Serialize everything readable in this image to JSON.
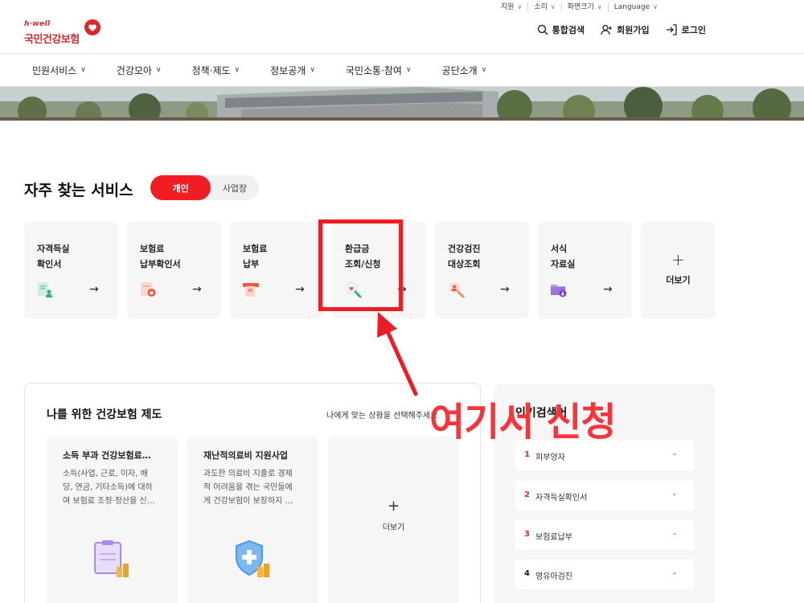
{
  "utility": {
    "items": [
      {
        "label": "지원"
      },
      {
        "label": "소리"
      },
      {
        "label": "화면크기"
      },
      {
        "label": "Language"
      }
    ]
  },
  "logo": {
    "small": "h·well",
    "main": "국민건강보험"
  },
  "header": {
    "search_label": "통합검색",
    "signup_label": "회원가입",
    "login_label": "로그인"
  },
  "gnb": {
    "items": [
      {
        "label": "민원서비스"
      },
      {
        "label": "건강모아"
      },
      {
        "label": "정책·제도"
      },
      {
        "label": "정보공개"
      },
      {
        "label": "국민소통·참여"
      },
      {
        "label": "공단소개"
      }
    ]
  },
  "services": {
    "title": "자주 찾는 서비스",
    "tabs": [
      {
        "label": "개인",
        "active": true
      },
      {
        "label": "사업장",
        "active": false
      }
    ],
    "cards": [
      {
        "line1": "자격득실",
        "line2": "확인서",
        "icon": "document-person-icon"
      },
      {
        "line1": "보험료",
        "line2": "납부확인서",
        "icon": "document-heart-icon"
      },
      {
        "line1": "보험료",
        "line2": "납부",
        "icon": "payment-card-icon"
      },
      {
        "line1": "환급금",
        "line2": "조회/신청",
        "icon": "magnifier-heart-icon"
      },
      {
        "line1": "건강검진",
        "line2": "대상조회",
        "icon": "magnifier-person-icon"
      },
      {
        "line1": "서식",
        "line2": "자료실",
        "icon": "folder-download-icon"
      }
    ],
    "more_label": "더보기",
    "arrow": "→",
    "plus": "+"
  },
  "annotation": {
    "text": "여기서 신청",
    "color": "#f6343b"
  },
  "program": {
    "title": "나를 위한 건강보험 제도",
    "hint": "나에게 맞는 상황을 선택해주세요",
    "cards": [
      {
        "title": "소득 부과 건강보험료…",
        "desc": [
          "소득(사업, 근로, 이자, 배",
          "당, 연금, 기타소득)에 대하",
          "여 보험료 조정·정산을 신…"
        ],
        "icon": "clipboard-coins-icon"
      },
      {
        "title": "재난적의료비 지원사업",
        "desc": [
          "과도한 의료비 지출로 경제",
          "적 어려움을 겪는 국민들에",
          "게 건강보험이 보장하지 …"
        ],
        "icon": "shield-plus-coins-icon"
      }
    ],
    "more_label": "더보기",
    "plus": "+"
  },
  "popular": {
    "title": "인기검색어",
    "items": [
      {
        "rank": "1",
        "label": "피부양자",
        "trend": "-",
        "hot": true
      },
      {
        "rank": "2",
        "label": "자격득실확인서",
        "trend": "-",
        "hot": true
      },
      {
        "rank": "3",
        "label": "보험료납부",
        "trend": "-",
        "hot": true
      },
      {
        "rank": "4",
        "label": "영유아검진",
        "trend": "-",
        "hot": false
      }
    ]
  },
  "colors": {
    "brand": "#e0262b",
    "active_tab": "#f11d22",
    "annotation": "#ee1c24"
  }
}
